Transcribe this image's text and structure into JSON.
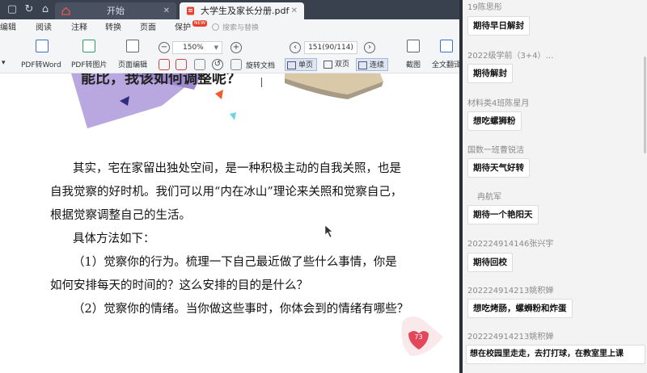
{
  "tabs": {
    "home": "开始",
    "file": "大学生及家长分册.pdf"
  },
  "menu": [
    "编辑",
    "阅读",
    "注释",
    "转换",
    "页面",
    "保护"
  ],
  "menu_new_badge": "NEW",
  "search_placeholder": "搜索与替换",
  "toolbar": {
    "pdf_to_word": "PDF转Word",
    "pdf_to_image": "PDF转图片",
    "page_edit": "页面编辑",
    "rotate_doc": "旋转文档",
    "single_page": "单页",
    "double_page": "双页",
    "continuous": "连续",
    "screenshot": "截图",
    "full_translate": "全文翻译",
    "zoom_value": "150%",
    "page_value": "151(90/114)"
  },
  "document": {
    "heading": "能比，我该如何调整呢？",
    "lines": [
      "其实，宅在家留出独处空间，是一种积极主动的自我关照，也是",
      "自我觉察的好时机。我们可以用“内在冰山”理论来关照和觉察自己，",
      "根据觉察调整自己的生活。",
      "具体方法如下：",
      "（1）觉察你的行为。梳理一下自己最近做了些什么事情，你是",
      "如何安排每天的时间的？这么安排的目的是什么？",
      "（2）觉察你的情绪。当你做这些事时，你体会到的情绪有哪些？"
    ],
    "page_number": "73"
  },
  "chat": {
    "messages": [
      {
        "sender": "19陈思彤",
        "text": "期待早日解封"
      },
      {
        "sender": "2022级学前（3+4）…",
        "text": "期待解封"
      },
      {
        "sender": "材料类4班陈星月",
        "text": "想吃螺狮粉"
      },
      {
        "sender": "国数一班曹锐洁",
        "text": "期待天气好转"
      },
      {
        "sender": "冉航军",
        "text": "期待一个艳阳天"
      },
      {
        "sender": "202224914146张兴宇",
        "text": "期待回校"
      },
      {
        "sender": "202224914213姚积婵",
        "text": "想吃烤肠，螺蛳粉和炸蛋"
      },
      {
        "sender": "202224914213姚积婵",
        "text": "想在校园里走走，去打打球，在教室里上课"
      }
    ]
  },
  "colors": {
    "tabbar": "#39414f",
    "toolbar": "#f4f5f7",
    "chat_bg": "#f3f3f3",
    "accent_red": "#e8422f",
    "purple_shape": "#b9a7df"
  }
}
